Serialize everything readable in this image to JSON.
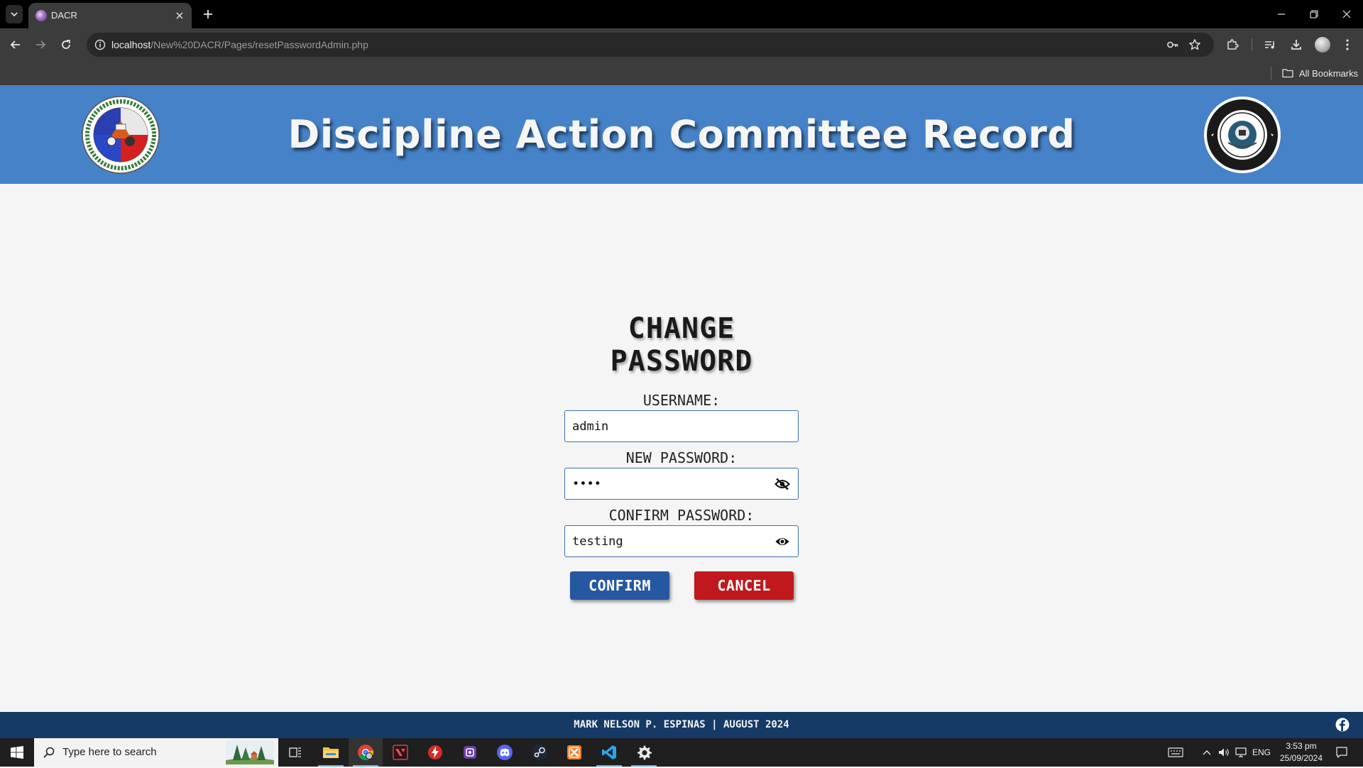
{
  "browser": {
    "tab_title": "DACR",
    "url_host": "localhost",
    "url_path": "/New%20DACR/Pages/resetPasswordAdmin.php",
    "bookmarks_label": "All Bookmarks"
  },
  "header": {
    "title": "Discipline Action Committee Record",
    "left_seal_icon": "school-seal-icon",
    "right_seal_icon": "grade12-cooper-seal-icon"
  },
  "form": {
    "title": "CHANGE PASSWORD",
    "username_label": "USERNAME:",
    "username_value": "admin",
    "new_password_label": "NEW PASSWORD:",
    "new_password_value": "test",
    "confirm_password_label": "CONFIRM PASSWORD:",
    "confirm_password_value": "testing",
    "confirm_button": "CONFIRM",
    "cancel_button": "CANCEL"
  },
  "footer": {
    "text": "MARK NELSON P. ESPINAS | AUGUST 2024"
  },
  "taskbar": {
    "search_placeholder": "Type here to search",
    "language": "ENG",
    "time": "3:53 pm",
    "date": "25/09/2024"
  },
  "colors": {
    "header_bg": "#4682c8",
    "footer_bg": "#153a66",
    "confirm_bg": "#2558a0",
    "cancel_bg": "#c0181c",
    "page_bg": "#f5f5f5"
  }
}
